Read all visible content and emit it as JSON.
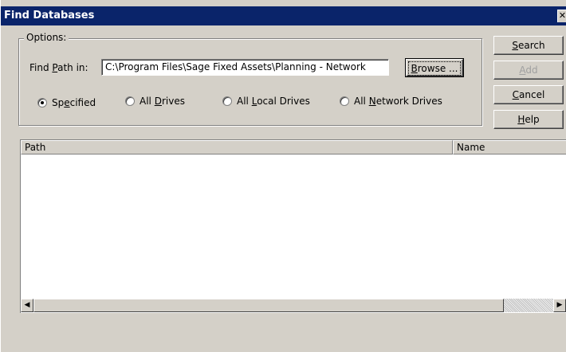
{
  "window": {
    "title": "Find Databases",
    "close": "✕"
  },
  "options": {
    "legend": "Options:",
    "find_path_label": "Find Path in:",
    "find_path_value": "C:\\Program Files\\Sage Fixed Assets\\Planning - Network",
    "browse_label": "Browse ..."
  },
  "radios": [
    {
      "label": "Specified",
      "checked": true
    },
    {
      "label": "All Drives",
      "checked": false
    },
    {
      "label": "All Local Drives",
      "checked": false
    },
    {
      "label": "All Network Drives",
      "checked": false
    }
  ],
  "buttons": {
    "search": "Search",
    "add": "Add",
    "cancel": "Cancel",
    "help": "Help"
  },
  "list": {
    "columns": [
      "Path",
      "Name"
    ],
    "rows": []
  },
  "scrollbar": {
    "left_arrow": "◀",
    "right_arrow": "▶"
  }
}
